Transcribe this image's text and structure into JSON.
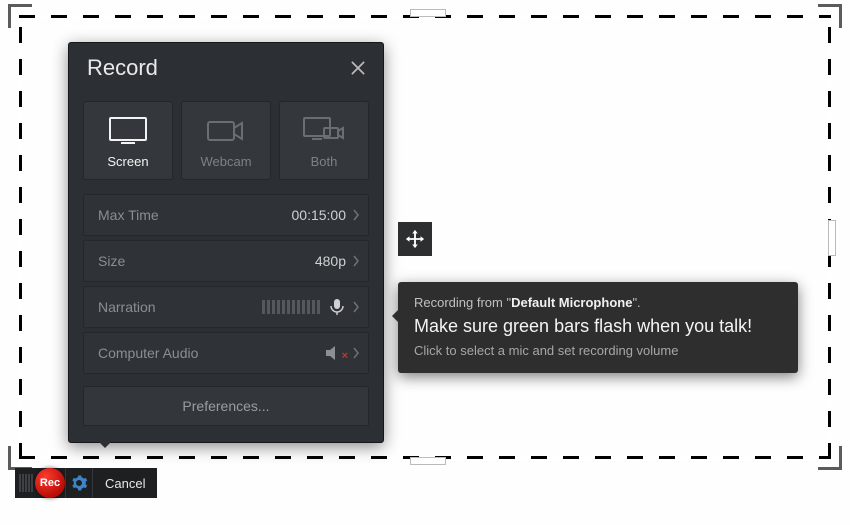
{
  "panel": {
    "title": "Record",
    "sources": [
      {
        "label": "Screen",
        "icon": "monitor-icon",
        "selected": true
      },
      {
        "label": "Webcam",
        "icon": "camera-icon",
        "selected": false
      },
      {
        "label": "Both",
        "icon": "monitor-camera-icon",
        "selected": false
      }
    ],
    "rows": {
      "max_time": {
        "label": "Max Time",
        "value": "00:15:00"
      },
      "size": {
        "label": "Size",
        "value": "480p"
      },
      "narration": {
        "label": "Narration"
      },
      "computer_audio": {
        "label": "Computer Audio"
      }
    },
    "preferences_label": "Preferences..."
  },
  "tooltip": {
    "prefix": "Recording from \"",
    "device": "Default Microphone",
    "suffix": "\".",
    "headline": "Make sure green bars flash when you talk!",
    "sub": "Click to select a mic and set recording volume"
  },
  "bottom_bar": {
    "rec_label": "Rec",
    "cancel_label": "Cancel"
  }
}
